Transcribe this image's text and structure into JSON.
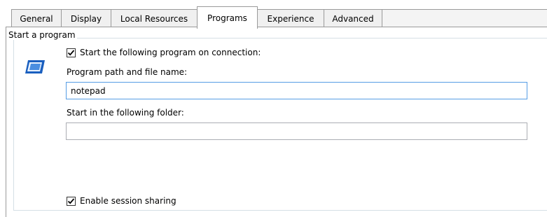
{
  "tabs": [
    {
      "label": "General"
    },
    {
      "label": "Display"
    },
    {
      "label": "Local Resources"
    },
    {
      "label": "Programs"
    },
    {
      "label": "Experience"
    },
    {
      "label": "Advanced"
    }
  ],
  "active_tab": "Programs",
  "start_program": {
    "group_title": "Start a program",
    "start_on_connection": {
      "label": "Start the following program on connection:",
      "checked": true
    },
    "program_path": {
      "label": "Program path and file name:",
      "value": "notepad"
    },
    "start_folder": {
      "label": "Start in the following folder:",
      "value": ""
    },
    "session_sharing": {
      "label": "Enable session sharing",
      "checked": true
    }
  },
  "icons": {
    "program": "monitor-window-icon",
    "check": "check-icon"
  },
  "colors": {
    "focus_border": "#569de5",
    "icon_blue": "#1a5fbf"
  }
}
